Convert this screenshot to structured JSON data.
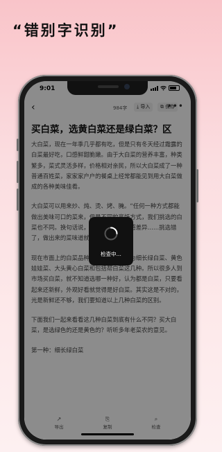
{
  "headline": "“错别字识别”",
  "status": {
    "time": "9:01"
  },
  "toolbar": {
    "back_icon": "‹",
    "word_count": "984字",
    "import_icon": "⤓",
    "import_label": "导入",
    "save_icon": "⧉",
    "save_label": "保存",
    "more_label": "•••"
  },
  "article": {
    "title": "买白菜，选黄白菜还是绿白菜？区",
    "paragraphs": [
      "大白菜，现在一年季几乎都有吃，但是只有冬天经过霜露的白菜最好吃，口感鲜甜脆嫩。由于大白菜的营养丰富，种类繁多，菜式灵活多样，价格相对亲民，所以大白菜成了一种普通百姓菜，家家家户户的餐桌上经常都能见到用大白菜做成的各种美味佳肴。",
      "大白菜可以用来炒、炖、烫、烤、腌。“任何一种方式都能做出美味可口的菜来，但是不同的烹饪方式，我们挑选的白菜也不同。换句话说，不同的白菜，口感差异……挑选错了，做出来的菜味道就不好。",
      "现在市面上的白菜品种很多，主要有分为细长绿白菜、黄色娃娃菜、大头黄心白菜和包括帮白菜这几种。所以很多人到市场买白菜，就不知道选哪一种好，认为都是白菜，只要看起来还新鲜，外观好看就觉得是好白菜。其实这是不对的，光是新鲜还不够，我们要知道以上几种白菜的区别。",
      "下面我们一起来看看这几种白菜到底有什么不同？买大白菜，是选绿色的还是黄色的？听听多年老菜农的意见。",
      "第一种：细长绿白菜"
    ]
  },
  "hud": {
    "label": "检查中..."
  },
  "bottom_bar": {
    "items": [
      {
        "icon": "↗",
        "label": "导出"
      },
      {
        "icon": "⎘",
        "label": "复制"
      },
      {
        "icon": "⌕",
        "label": "检查"
      }
    ]
  }
}
